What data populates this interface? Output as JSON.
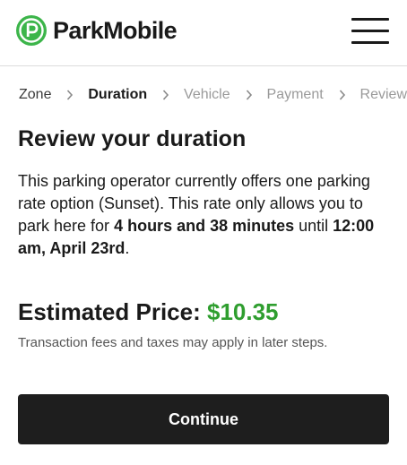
{
  "header": {
    "brand_name": "ParkMobile",
    "brand_color": "#3cb54a",
    "logo_icon": "parkmobile-p-icon",
    "menu_icon": "hamburger-menu-icon"
  },
  "breadcrumb": {
    "steps": [
      {
        "label": "Zone",
        "state": "done"
      },
      {
        "label": "Duration",
        "state": "active"
      },
      {
        "label": "Vehicle",
        "state": "upcoming"
      },
      {
        "label": "Payment",
        "state": "upcoming"
      },
      {
        "label": "Review",
        "state": "upcoming"
      }
    ],
    "separator_icon": "chevron-right-icon"
  },
  "main": {
    "title": "Review your duration",
    "description": {
      "part1": "This parking operator currently offers one parking rate option (Sunset). This rate only allows you to park here for ",
      "duration": "4 hours and 38 minutes",
      "part2": " until ",
      "end_time": "12:00 am, April 23rd",
      "part3": "."
    },
    "price_label": "Estimated Price:",
    "price_value": "$10.35",
    "price_color": "#2f9e2f",
    "fees_note": "Transaction fees and taxes may apply in later steps.",
    "continue_label": "Continue"
  }
}
